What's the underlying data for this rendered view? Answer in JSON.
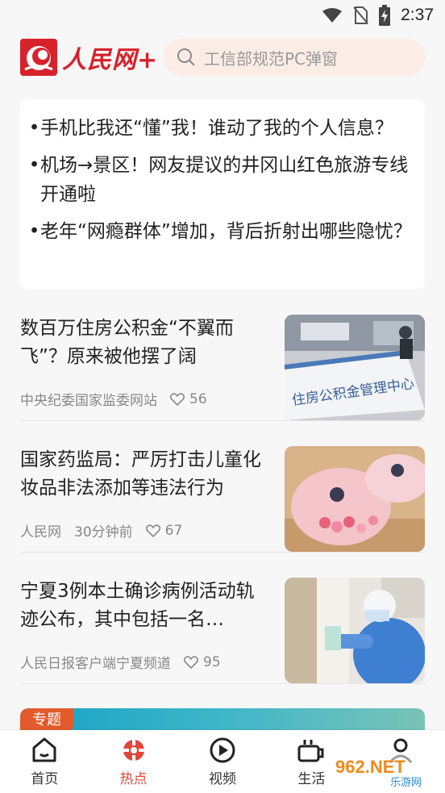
{
  "status": {
    "time": "2:37"
  },
  "header": {
    "logo_text": "人民网+",
    "search_placeholder": "工信部规范PC弹窗"
  },
  "hot_list": [
    {
      "bullet": "•",
      "text": "手机比我还“懂”我！谁动了我的个人信息？"
    },
    {
      "bullet": "•",
      "text": "机场→景区！网友提议的井冈山红色旅游专线开通啦"
    },
    {
      "bullet": "•",
      "text": "老年“网瘾群体”增加，背后折射出哪些隐忧？"
    }
  ],
  "news": [
    {
      "title": "数百万住房公积金“不翼而飞”？原来被他摆了阔",
      "source": "中央纪委国家监委网站",
      "time": "",
      "likes": "56",
      "image": "housing-fund-office-photo"
    },
    {
      "title": "国家药监局：严厉打击儿童化妆品非法添加等违法行为",
      "source": "人民网",
      "time": "30分钟前",
      "likes": "67",
      "image": "children-cosmetics-photo"
    },
    {
      "title": "宁夏3例本土确诊病例活动轨迹公布，其中包括一名…",
      "source": "人民日报客户端宁夏频道",
      "time": "",
      "likes": "95",
      "image": "medical-worker-photo"
    }
  ],
  "topic": {
    "tag": "专题"
  },
  "tabs": [
    {
      "label": "首页",
      "icon": "home-icon",
      "active": false
    },
    {
      "label": "热点",
      "icon": "hot-icon",
      "active": true
    },
    {
      "label": "视频",
      "icon": "video-icon",
      "active": false
    },
    {
      "label": "生活",
      "icon": "life-icon",
      "active": false
    },
    {
      "label": "",
      "icon": "profile-icon",
      "active": false
    }
  ],
  "watermark": {
    "line1": "962.NET",
    "line2": "乐游网"
  },
  "colors": {
    "brand": "#d7212b",
    "active_tab": "#e0463a",
    "search_bg": "#fbece6",
    "topic_tag": "#e35b2c"
  }
}
